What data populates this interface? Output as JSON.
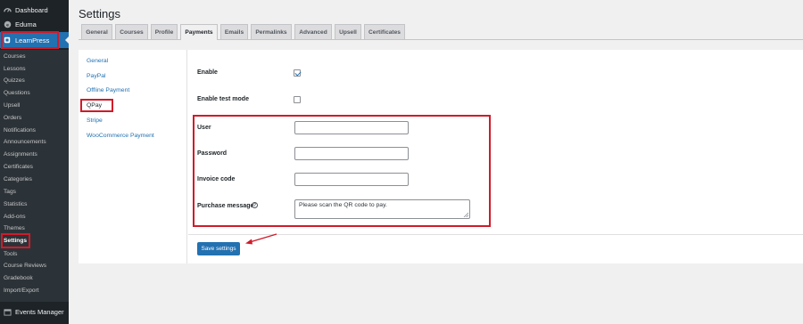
{
  "sidebar": {
    "top_items": [
      {
        "label": "Dashboard",
        "icon": "dashboard-icon"
      },
      {
        "label": "Eduma",
        "icon": "eduma-logo-icon"
      }
    ],
    "learnpress": {
      "label": "LearnPress",
      "icon": "learnpress-icon"
    },
    "sub_items": [
      "Courses",
      "Lessons",
      "Quizzes",
      "Questions",
      "Upsell",
      "Orders",
      "Notifications",
      "Announcements",
      "Assignments",
      "Certificates",
      "Categories",
      "Tags",
      "Statistics",
      "Add-ons",
      "Themes",
      "Settings",
      "Tools",
      "Course Reviews",
      "Gradebook",
      "Import/Export"
    ],
    "current_sub": "Settings",
    "bottom_item": {
      "label": "Events Manager",
      "icon": "calendar-icon"
    }
  },
  "page": {
    "title": "Settings"
  },
  "tabs": [
    "General",
    "Courses",
    "Profile",
    "Payments",
    "Emails",
    "Permalinks",
    "Advanced",
    "Upsell",
    "Certificates"
  ],
  "active_tab": "Payments",
  "payment_nav": [
    "General",
    "PayPal",
    "Offline Payment",
    "QPay",
    "Stripe",
    "WooCommerce Payment"
  ],
  "form": {
    "enable_label": "Enable",
    "enable_checked": true,
    "test_mode_label": "Enable test mode",
    "test_mode_checked": false,
    "user_label": "User",
    "password_label": "Password",
    "invoice_label": "Invoice code",
    "purchase_label": "Purchase message",
    "purchase_value": "Please scan the QR code to pay.",
    "help_glyph": "?"
  },
  "save_label": "Save settings",
  "colors": {
    "accent": "#2271b1",
    "highlight": "#d01b2a",
    "sidebar_bg": "#1d2327"
  }
}
